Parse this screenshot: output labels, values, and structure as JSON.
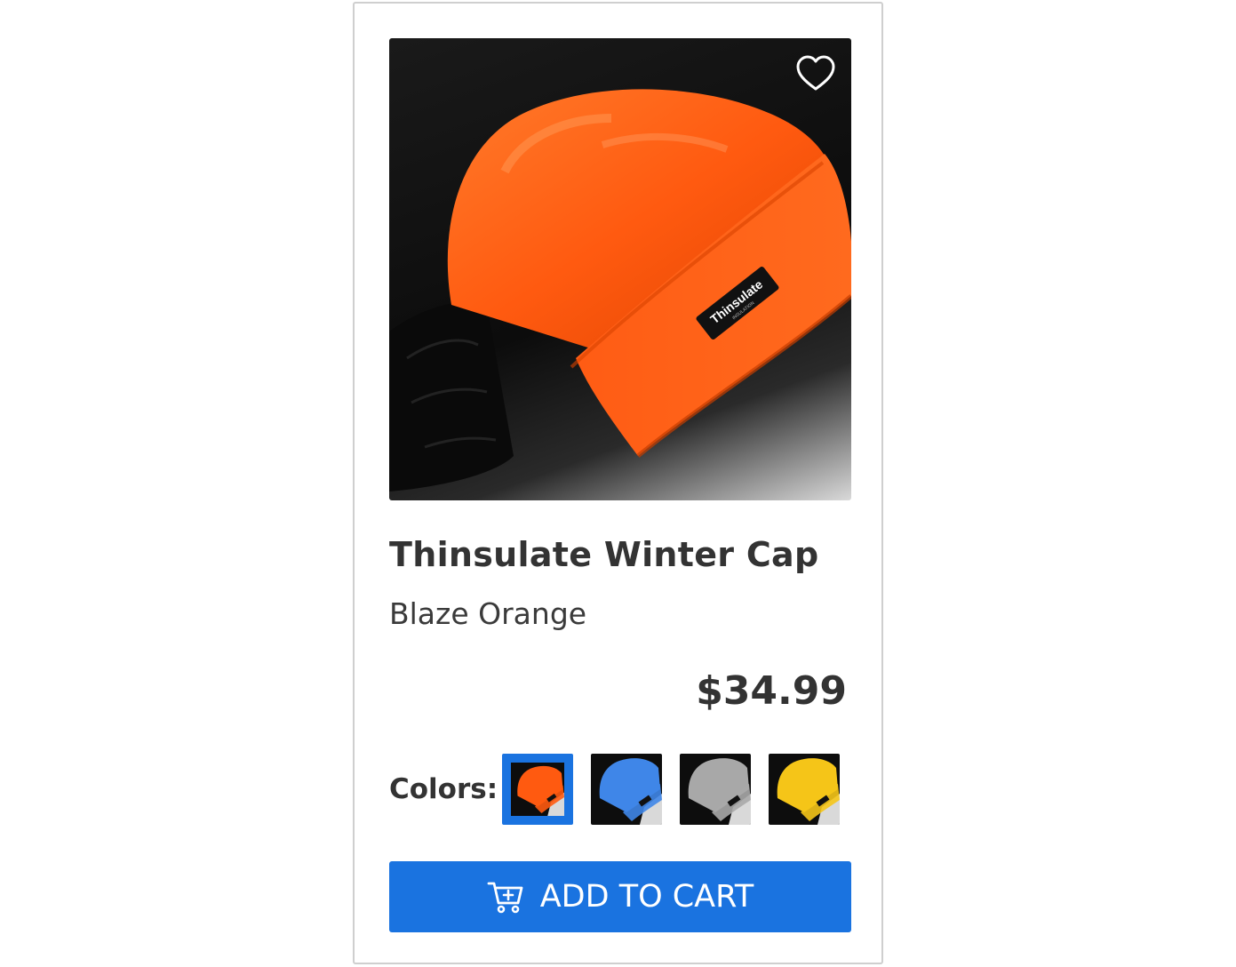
{
  "product": {
    "name": "Thinsulate Winter Cap",
    "variant": "Blaze Orange",
    "price": "$34.99",
    "image_label": "Thinsulate",
    "image_label_small": "INSULATION"
  },
  "wishlist": {
    "icon": "heart-outline-icon"
  },
  "colors": {
    "label": "Colors:",
    "swatches": [
      {
        "name": "Blaze Orange",
        "color": "#ff5a10",
        "selected": true
      },
      {
        "name": "Blue",
        "color": "#3f86e8",
        "selected": false
      },
      {
        "name": "Gray",
        "color": "#a8a8a8",
        "selected": false
      },
      {
        "name": "Yellow",
        "color": "#f5c518",
        "selected": false
      }
    ]
  },
  "cart": {
    "label": "ADD TO CART",
    "icon": "cart-plus-icon"
  },
  "theme": {
    "accent": "#1a73e0",
    "border": "#cfcfcf",
    "text": "#333333"
  }
}
